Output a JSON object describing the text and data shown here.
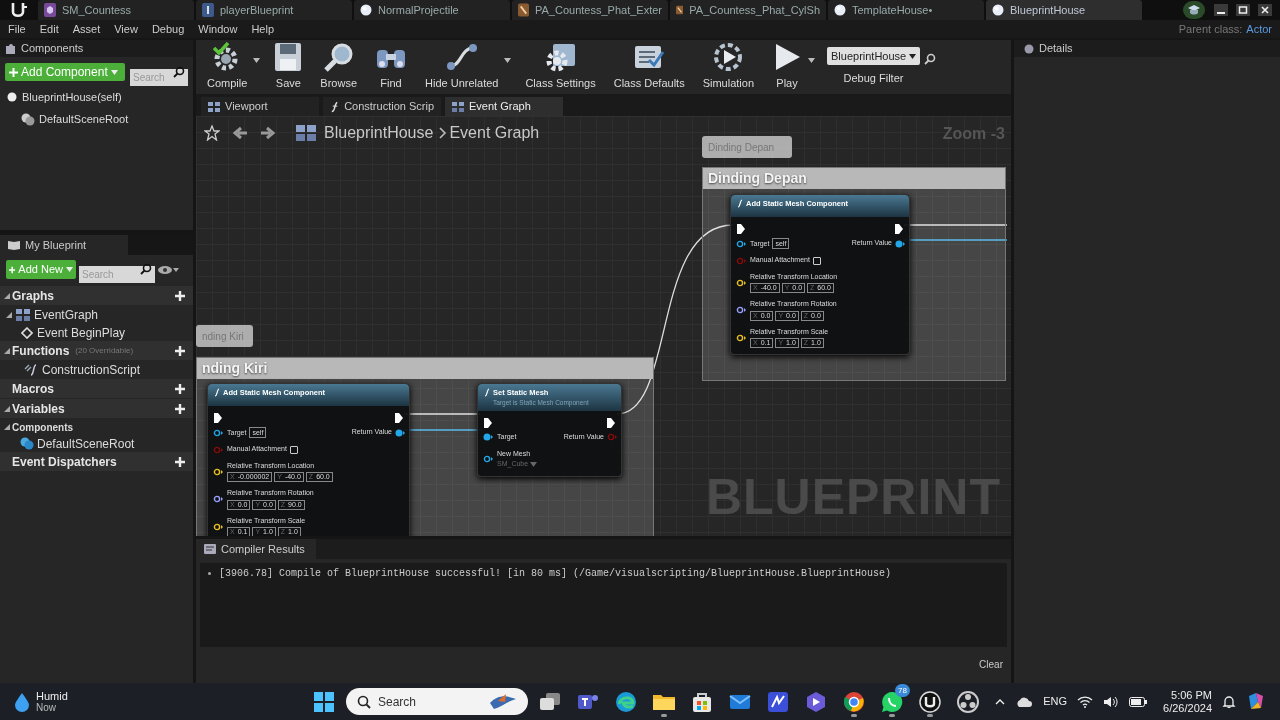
{
  "editor_tabs": [
    {
      "kind": "mesh",
      "label": "SM_Countess",
      "selected": false
    },
    {
      "kind": "blueprint",
      "label": "playerBlueprint",
      "selected": false
    },
    {
      "kind": "sphere",
      "label": "NormalProjectile",
      "selected": false
    },
    {
      "kind": "physics",
      "label": "PA_Countess_Phat_Exter",
      "selected": false
    },
    {
      "kind": "physics",
      "label": "PA_Countess_Phat_CylSh",
      "selected": false
    },
    {
      "kind": "sphere",
      "label": "TemplateHouse•",
      "selected": false
    },
    {
      "kind": "sphere",
      "label": "BlueprintHouse",
      "selected": true
    }
  ],
  "menu": [
    "File",
    "Edit",
    "Asset",
    "View",
    "Debug",
    "Window",
    "Help"
  ],
  "parent_class": {
    "label": "Parent class:",
    "value": "Actor"
  },
  "components_panel": {
    "title": "Components",
    "add_button": "Add Component",
    "search_placeholder": "Search",
    "tree": [
      {
        "label": "BlueprintHouse(self)",
        "children": [
          {
            "label": "DefaultSceneRoot"
          }
        ]
      }
    ]
  },
  "toolbar": [
    {
      "kind": "compile",
      "label": "Compile",
      "dropdown": true
    },
    {
      "kind": "save",
      "label": "Save",
      "dropdown": false
    },
    {
      "kind": "browse",
      "label": "Browse",
      "dropdown": false
    },
    {
      "kind": "find",
      "label": "Find",
      "dropdown": false
    },
    {
      "kind": "hide_unrelated",
      "label": "Hide Unrelated",
      "dropdown": true
    },
    {
      "kind": "class_settings",
      "label": "Class Settings",
      "dropdown": false
    },
    {
      "kind": "class_defaults",
      "label": "Class Defaults",
      "dropdown": false
    },
    {
      "kind": "simulation",
      "label": "Simulation",
      "dropdown": false
    },
    {
      "kind": "play",
      "label": "Play",
      "dropdown": true
    }
  ],
  "debug_filter": {
    "value": "BlueprintHouse",
    "label": "Debug Filter"
  },
  "graph_tabs": [
    {
      "kind": "viewport",
      "label": "Viewport",
      "selected": false
    },
    {
      "kind": "function",
      "label": "Construction Scrip",
      "selected": false
    },
    {
      "kind": "graph",
      "label": "Event Graph",
      "selected": true
    }
  ],
  "my_blueprint": {
    "title": "My Blueprint",
    "add_button": "Add New",
    "search_placeholder": "Search",
    "sections": [
      {
        "title": "Graphs",
        "expanded": true,
        "items": [
          {
            "kind": "graph",
            "label": "EventGraph",
            "children": [
              {
                "kind": "event",
                "label": "Event BeginPlay"
              }
            ]
          }
        ]
      },
      {
        "title": "Functions",
        "note": "(20 Overridable)",
        "expanded": true,
        "items": [
          {
            "kind": "function",
            "label": "ConstructionScript"
          }
        ]
      },
      {
        "title": "Macros",
        "expanded": false
      },
      {
        "title": "Variables",
        "expanded": true,
        "groups": [
          {
            "title": "Components",
            "items": [
              {
                "kind": "scene",
                "label": "DefaultSceneRoot"
              }
            ]
          }
        ]
      },
      {
        "title": "Event Dispatchers",
        "expanded": false
      }
    ]
  },
  "graph": {
    "breadcrumb": [
      "BlueprintHouse",
      "Event Graph"
    ],
    "zoom": "Zoom -3",
    "watermark": "BLUEPRINT",
    "comments": [
      {
        "title": "Dinding Depan",
        "bubble": "Dinding Depan",
        "nodes": [
          {
            "title": "Add Static Mesh Component",
            "inputs": [
              {
                "kind": "object",
                "label": "Target",
                "default": "self",
                "connected": false
              },
              {
                "kind": "bool",
                "label": "Manual Attachment",
                "checked": false,
                "connected": false
              },
              {
                "kind": "vector",
                "label": "Relative Transform Location",
                "connected": false,
                "fields": [
                  {
                    "axis": "X",
                    "value": "-40.0"
                  },
                  {
                    "axis": "Y",
                    "value": "0.0"
                  },
                  {
                    "axis": "Z",
                    "value": "60.0"
                  }
                ]
              },
              {
                "kind": "rotator",
                "label": "Relative Transform Rotation",
                "connected": false,
                "fields": [
                  {
                    "axis": "X",
                    "value": "0.0"
                  },
                  {
                    "axis": "Y",
                    "value": "0.0"
                  },
                  {
                    "axis": "Z",
                    "value": "0.0"
                  }
                ]
              },
              {
                "kind": "vector",
                "label": "Relative Transform Scale",
                "connected": false,
                "fields": [
                  {
                    "axis": "X",
                    "value": "0.1"
                  },
                  {
                    "axis": "Y",
                    "value": "1.0"
                  },
                  {
                    "axis": "Z",
                    "value": "1.0"
                  }
                ]
              }
            ],
            "outputs": [
              {
                "kind": "object",
                "label": "Return Value",
                "connected": true
              }
            ]
          }
        ]
      },
      {
        "title": "nding Kiri",
        "bubble": "nding Kiri",
        "nodes": [
          {
            "title": "Add Static Mesh Component",
            "inputs": [
              {
                "kind": "object",
                "label": "Target",
                "default": "self",
                "connected": false
              },
              {
                "kind": "bool",
                "label": "Manual Attachment",
                "checked": false,
                "connected": false
              },
              {
                "kind": "vector",
                "label": "Relative Transform Location",
                "connected": false,
                "fields": [
                  {
                    "axis": "X",
                    "value": "-0.000002"
                  },
                  {
                    "axis": "Y",
                    "value": "-40.0"
                  },
                  {
                    "axis": "Z",
                    "value": "60.0"
                  }
                ]
              },
              {
                "kind": "rotator",
                "label": "Relative Transform Rotation",
                "connected": false,
                "fields": [
                  {
                    "axis": "X",
                    "value": "0.0"
                  },
                  {
                    "axis": "Y",
                    "value": "0.0"
                  },
                  {
                    "axis": "Z",
                    "value": "90.0"
                  }
                ]
              },
              {
                "kind": "vector",
                "label": "Relative Transform Scale",
                "connected": false,
                "fields": [
                  {
                    "axis": "X",
                    "value": "0.1"
                  },
                  {
                    "axis": "Y",
                    "value": "1.0"
                  },
                  {
                    "axis": "Z",
                    "value": "1.0"
                  }
                ]
              }
            ],
            "outputs": [
              {
                "kind": "object",
                "label": "Return Value",
                "connected": true
              }
            ]
          },
          {
            "title": "Set Static Mesh",
            "subtitle": "Target is Static Mesh Component",
            "inputs": [
              {
                "kind": "object",
                "label": "Target",
                "connected": true
              },
              {
                "kind": "object",
                "label": "New Mesh",
                "asset": "SM_Cube",
                "connected": false
              }
            ],
            "outputs": [
              {
                "kind": "bool",
                "label": "Return Value",
                "connected": false
              }
            ]
          }
        ]
      }
    ]
  },
  "compiler_results": {
    "title": "Compiler Results",
    "messages": [
      "[3906.78] Compile of BlueprintHouse successful! [in 80 ms] (/Game/visualscripting/BlueprintHouse.BlueprintHouse)"
    ],
    "clear_button": "Clear"
  },
  "details": {
    "title": "Details"
  },
  "taskbar": {
    "weather": {
      "title": "Humid",
      "subtitle": "Now"
    },
    "search_placeholder": "Search",
    "apps": [
      {
        "kind": "task_view",
        "running": false
      },
      {
        "kind": "teams",
        "running": false
      },
      {
        "kind": "edge",
        "running": false
      },
      {
        "kind": "explorer",
        "running": true
      },
      {
        "kind": "store",
        "running": false
      },
      {
        "kind": "mail",
        "running": false
      },
      {
        "kind": "tile",
        "running": false
      },
      {
        "kind": "hexagon",
        "running": false
      },
      {
        "kind": "chrome",
        "running": true
      },
      {
        "kind": "whatsapp",
        "running": true,
        "badge": "78"
      },
      {
        "kind": "unreal",
        "running": true
      },
      {
        "kind": "obs",
        "running": false
      }
    ],
    "language": "ENG",
    "time": "5:06 PM",
    "date": "6/26/2024"
  }
}
